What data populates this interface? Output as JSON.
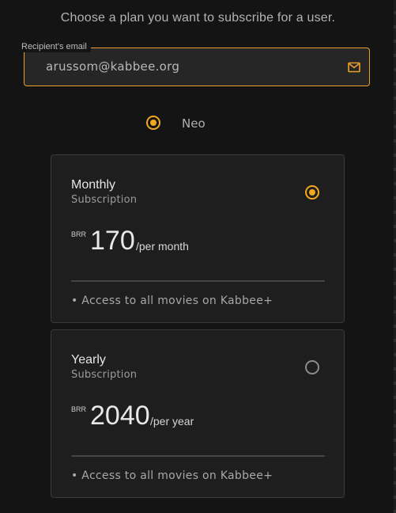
{
  "heading": "Choose a plan you want to subscribe for a user.",
  "email_field": {
    "label": "Recipient's email",
    "value": "arussom@kabbee.org",
    "icon": "mail-icon"
  },
  "product": {
    "label": "Neo",
    "selected": true
  },
  "plans": [
    {
      "title": "Monthly",
      "subtitle": "Subscription",
      "currency": "BRR",
      "price": "170",
      "period": "/per month",
      "feature": "• Access to all movies on Kabbee+",
      "selected": true
    },
    {
      "title": "Yearly",
      "subtitle": "Subscription",
      "currency": "BRR",
      "price": "2040",
      "period": "/per year",
      "feature": "• Access to all movies on Kabbee+",
      "selected": false
    }
  ],
  "colors": {
    "accent": "#f2a81d",
    "background": "#141414",
    "card": "#1e1e1e"
  }
}
